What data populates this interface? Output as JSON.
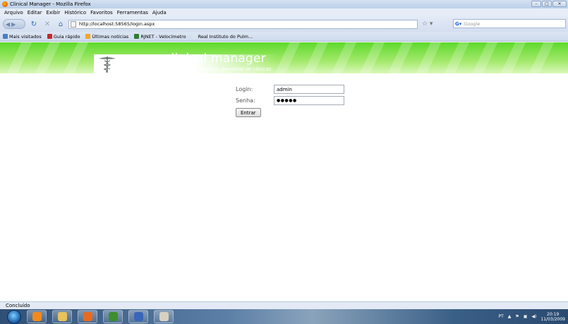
{
  "window": {
    "title": "Clinical Manager - Mozilla Firefox",
    "minimize": "–",
    "maximize": "□",
    "close": "✕"
  },
  "menu": [
    "Arquivo",
    "Editar",
    "Exibir",
    "Histórico",
    "Favoritos",
    "Ferramentas",
    "Ajuda"
  ],
  "nav": {
    "url": "http://localhost:58565/login.aspx",
    "search_placeholder": "Google"
  },
  "bookmarks": [
    "Mais visitados",
    "Guia rápido",
    "Últimas notícias",
    "RJNET - Velocímetro",
    "Real Instituto do Pulm..."
  ],
  "bookmark_colors": [
    "#4a7fc1",
    "#c62828",
    "#f5a623",
    "#2e7d32",
    "#d9e4f2"
  ],
  "banner": {
    "title": "clinical manager",
    "subtitle": "controle gerencial de clínicas",
    "accent": "#5ed92c"
  },
  "login": {
    "login_label": "Login:",
    "login_value": "admin",
    "senha_label": "Senha:",
    "senha_value": "●●●●●",
    "submit_label": "Entrar"
  },
  "status": {
    "text": "Concluído"
  },
  "taskbar": {
    "lang": "PT",
    "time": "20:19",
    "date": "11/03/2009",
    "app_colors": [
      "#f08a1c",
      "#e8c25a",
      "#e96a1f",
      "#3c8e2e",
      "#3a66b8",
      "#d8d0c0"
    ]
  }
}
